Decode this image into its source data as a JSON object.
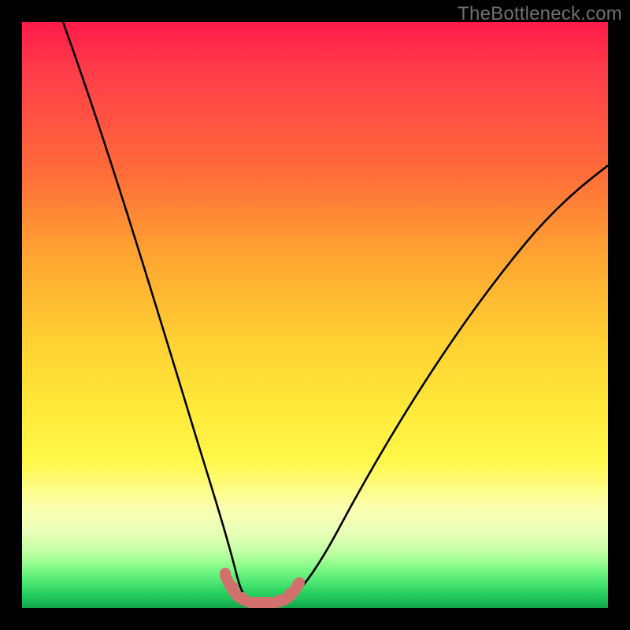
{
  "watermark": "TheBottleneck.com",
  "colors": {
    "frame": "#000000",
    "curve": "#000000",
    "marker": "#d2706e",
    "text": "#6f6f6f"
  },
  "chart_data": {
    "type": "line",
    "title": "",
    "xlabel": "",
    "ylabel": "",
    "xlim": [
      0,
      100
    ],
    "ylim": [
      0,
      100
    ],
    "grid": false,
    "legend": false,
    "series": [
      {
        "name": "left-curve",
        "x": [
          7,
          10,
          13,
          16,
          19,
          22,
          25,
          28,
          30,
          32,
          34,
          35,
          36,
          37,
          38
        ],
        "values": [
          100,
          88,
          76,
          64,
          53,
          42,
          32,
          23,
          16,
          10,
          6,
          4,
          2.5,
          1.5,
          1
        ]
      },
      {
        "name": "right-curve",
        "x": [
          44,
          46,
          49,
          53,
          58,
          64,
          71,
          79,
          88,
          100
        ],
        "values": [
          1,
          3,
          7,
          13,
          22,
          33,
          45,
          57,
          68,
          78
        ]
      },
      {
        "name": "bottom-optimal",
        "x": [
          35,
          37,
          39,
          41,
          43,
          45,
          46
        ],
        "values": [
          5,
          2.5,
          1.5,
          1.2,
          1.2,
          2,
          3.5
        ]
      }
    ]
  }
}
